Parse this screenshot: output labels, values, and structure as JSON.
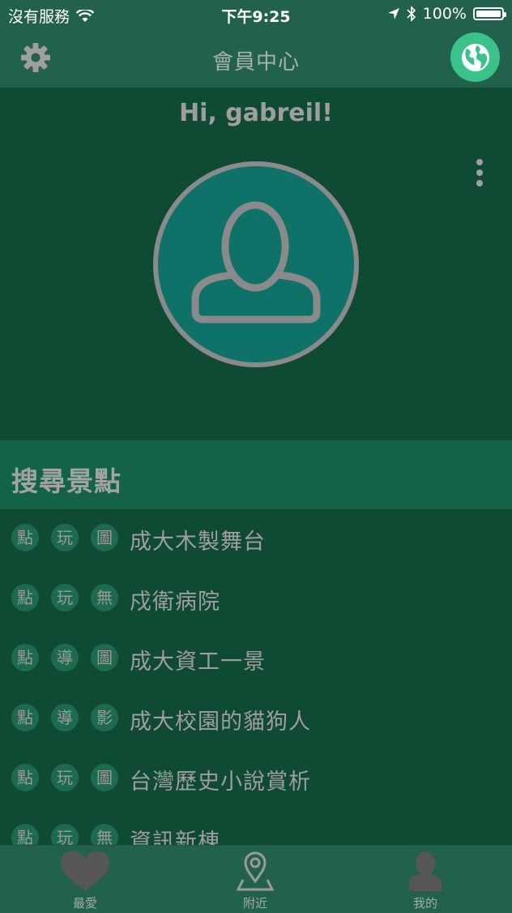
{
  "status_bar": {
    "carrier": "沒有服務",
    "time": "下午9:25",
    "battery": "100%"
  },
  "nav": {
    "title": "會員中心"
  },
  "profile": {
    "greeting": "Hi, gabreil!"
  },
  "section": {
    "title": "搜尋景點"
  },
  "places": [
    {
      "tags": [
        "點",
        "玩",
        "圖"
      ],
      "name": "成大木製舞台"
    },
    {
      "tags": [
        "點",
        "玩",
        "無"
      ],
      "name": "戍衛病院"
    },
    {
      "tags": [
        "點",
        "導",
        "圖"
      ],
      "name": "成大資工一景"
    },
    {
      "tags": [
        "點",
        "導",
        "影"
      ],
      "name": "成大校園的貓狗人"
    },
    {
      "tags": [
        "點",
        "玩",
        "圖"
      ],
      "name": "台灣歷史小說賞析"
    },
    {
      "tags": [
        "點",
        "玩",
        "無"
      ],
      "name": "資訊新棟"
    }
  ],
  "tabs": [
    {
      "label": "最愛",
      "icon": "heart-icon"
    },
    {
      "label": "附近",
      "icon": "map-pin-icon"
    },
    {
      "label": "我的",
      "icon": "person-icon"
    }
  ],
  "colors": {
    "background": "#0f4a33",
    "bar": "#22614b",
    "accent": "#3bc28a",
    "avatar_fill": "#0f7268",
    "section": "#12634a"
  }
}
